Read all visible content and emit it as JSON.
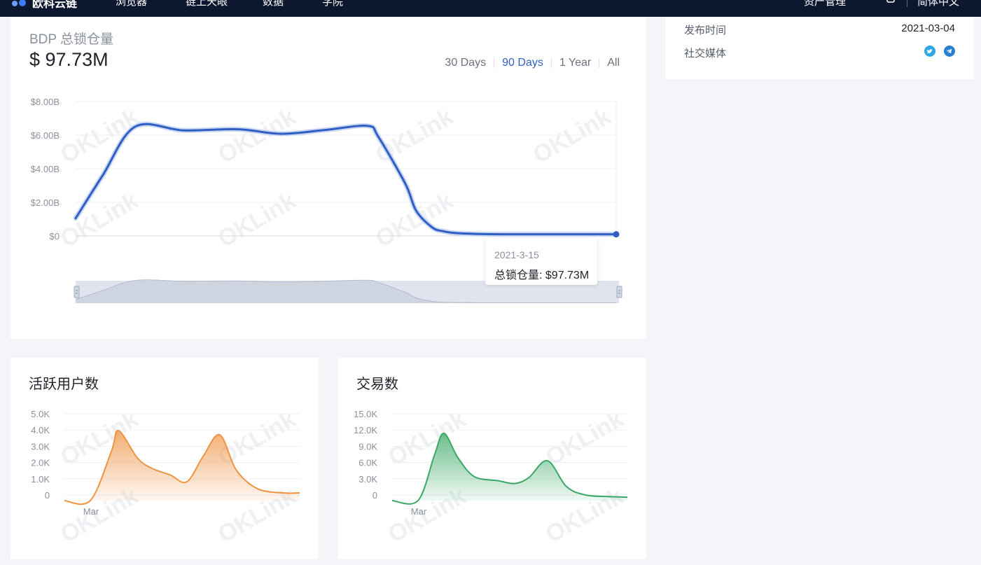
{
  "topbar": {
    "brand": "欧科云链",
    "nav": [
      "浏览器",
      "链上天眼",
      "数据",
      "学院"
    ],
    "right": [
      "资产管理",
      "简体中文"
    ]
  },
  "side_info": {
    "release_label": "发布时间",
    "release_value": "2021-03-04",
    "social_label": "社交媒体",
    "social_icons": [
      "twitter-icon",
      "telegram-icon"
    ]
  },
  "tvl": {
    "title": "BDP 总锁仓量",
    "value": "$ 97.73M",
    "ranges": [
      "30 Days",
      "90 Days",
      "1 Year",
      "All"
    ],
    "active_range": "90 Days",
    "tooltip_date": "2021-3-15",
    "tooltip_label": "总锁仓量: $97.73M"
  },
  "watermark": "OKLink",
  "colors": {
    "tvl_line": "#2f5fc4",
    "users_line": "#ee9443",
    "tx_line": "#3aa865",
    "nav_bg": "#0d1730",
    "active_range": "#2f5fc4"
  },
  "chart_data": [
    {
      "type": "line",
      "title": "BDP 总锁仓量",
      "y_tick_labels": [
        "$0",
        "$2.00B",
        "$4.00B",
        "$6.00B",
        "$8.00B"
      ],
      "ylim": [
        0,
        8
      ],
      "y_unit": "B",
      "x": [
        0,
        0.05,
        0.11,
        0.2,
        0.3,
        0.38,
        0.46,
        0.54,
        0.56,
        0.61,
        0.63,
        0.66,
        0.68,
        0.7,
        0.74,
        0.8,
        0.9,
        1.0
      ],
      "values": [
        1.05,
        3.6,
        6.5,
        6.28,
        6.35,
        6.08,
        6.3,
        6.55,
        5.9,
        3.1,
        1.5,
        0.5,
        0.28,
        0.18,
        0.12,
        0.1,
        0.1,
        0.098
      ],
      "grid": true,
      "legend": "none"
    },
    {
      "type": "area",
      "title": "活跃用户数",
      "y_tick_labels": [
        "0",
        "1.0K",
        "2.0K",
        "3.0K",
        "4.0K",
        "5.0K"
      ],
      "ylim": [
        0,
        5000
      ],
      "x_tick_labels": [
        "Mar"
      ],
      "x": [
        0,
        0.11,
        0.2,
        0.23,
        0.31,
        0.37,
        0.45,
        0.52,
        0.59,
        0.66,
        0.73,
        0.82,
        0.93,
        1.0
      ],
      "values": [
        0,
        0,
        2900,
        4100,
        2500,
        1900,
        1500,
        1100,
        2600,
        3850,
        1800,
        700,
        450,
        450
      ],
      "grid": true
    },
    {
      "type": "area",
      "title": "交易数",
      "y_tick_labels": [
        "0",
        "3.0K",
        "6.0K",
        "9.0K",
        "12.0K",
        "15.0K"
      ],
      "ylim": [
        0,
        15000
      ],
      "x_tick_labels": [
        "Mar"
      ],
      "x": [
        0,
        0.11,
        0.18,
        0.22,
        0.28,
        0.35,
        0.45,
        0.52,
        0.58,
        0.66,
        0.74,
        0.82,
        0.92,
        1.0
      ],
      "values": [
        0,
        0,
        8000,
        11800,
        7500,
        4200,
        3500,
        3000,
        4000,
        7000,
        2500,
        1000,
        700,
        600
      ],
      "grid": true
    }
  ]
}
